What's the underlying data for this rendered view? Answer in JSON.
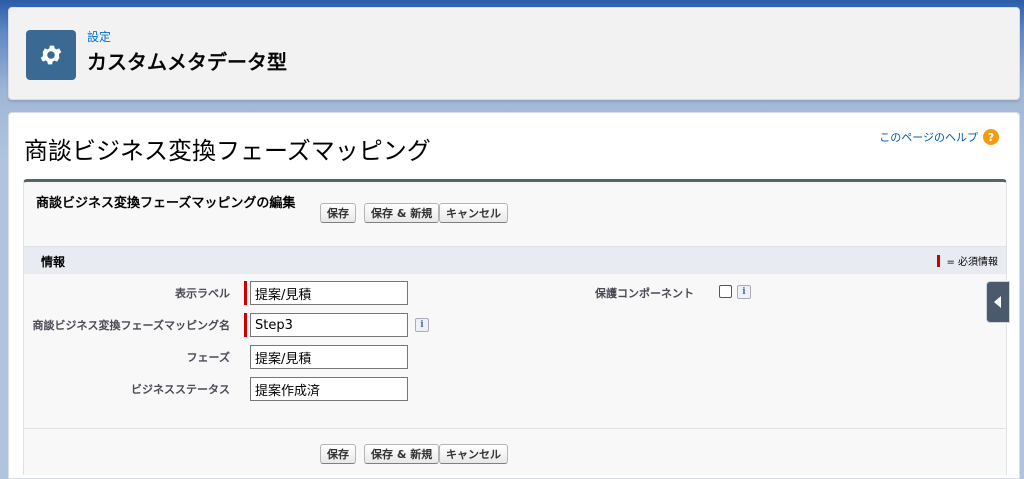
{
  "header": {
    "breadcrumb": "設定",
    "title": "カスタムメタデータ型",
    "icon": "gear-icon"
  },
  "page": {
    "title": "商談ビジネス変換フェーズマッピング",
    "help_link": "このページのヘルプ",
    "help_icon": "?"
  },
  "edit": {
    "title": "商談ビジネス変換フェーズマッピングの編集",
    "buttons": {
      "save": "保存",
      "save_new": "保存 & 新規",
      "cancel": "キャンセル"
    }
  },
  "section": {
    "title": "情報",
    "required_legend": "= 必須情報"
  },
  "fields": [
    {
      "label": "表示ラベル",
      "value": "提案/見積",
      "required": true
    },
    {
      "label": "商談ビジネス変換フェーズマッピング名",
      "value": "Step3",
      "required": true
    },
    {
      "label": "フェーズ",
      "value": "提案/見積",
      "required": false
    },
    {
      "label": "ビジネスステータス",
      "value": "提案作成済",
      "required": false
    }
  ],
  "protected": {
    "label": "保護コンポーネント",
    "checked": false
  },
  "info_icon_glyph": "i",
  "colors": {
    "accent": "#0070d2",
    "required": "#cc0000",
    "help": "#f39c12"
  }
}
